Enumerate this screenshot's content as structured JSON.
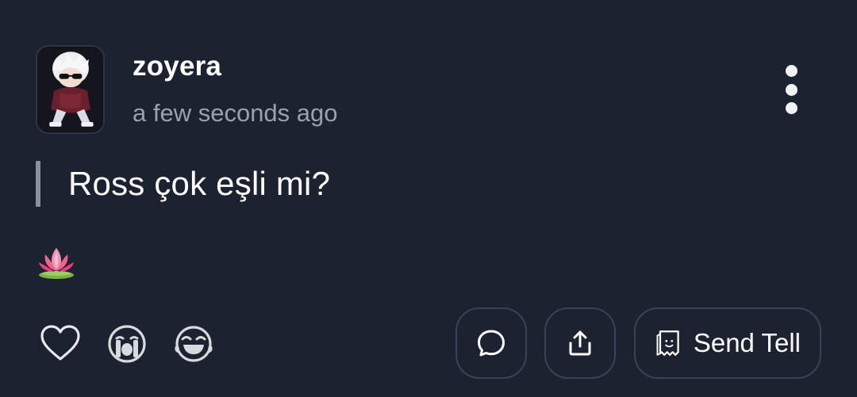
{
  "post": {
    "username": "zoyera",
    "timestamp": "a few seconds ago",
    "quote": "Ross çok eşli mi?",
    "emoji": "lotus-emoji"
  },
  "actions": {
    "send_tell_label": "Send Tell"
  },
  "icons": {
    "more": "more-vertical-icon",
    "like": "heart-icon",
    "cry": "crying-face-icon",
    "laugh": "laughing-face-icon",
    "comment": "comment-bubble-icon",
    "share": "share-upload-icon",
    "tell": "tell-note-icon"
  },
  "colors": {
    "background": "#1c2230",
    "text": "#ffffff",
    "muted": "#9aa1ad",
    "quote_bar": "#8a90a0",
    "pill_border": "#3a4354"
  }
}
